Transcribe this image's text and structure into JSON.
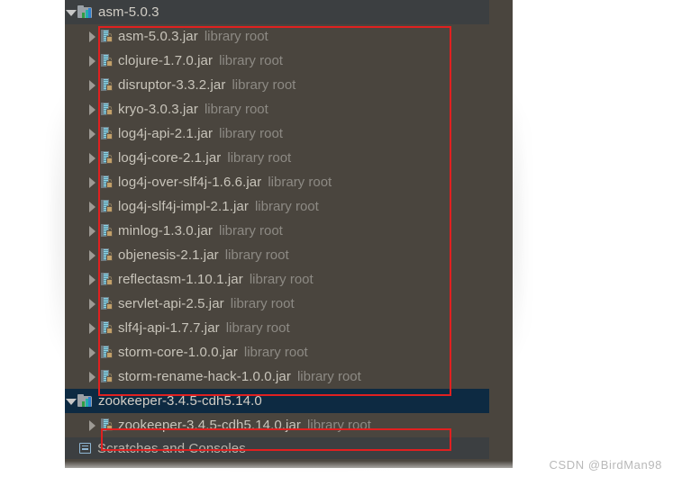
{
  "panel": {
    "kind": "project-tree",
    "colors": {
      "panel_bg": "#4a453e",
      "group_row_bg": "#3c3f41",
      "selected_row_bg": "#0d2a42",
      "gutter_bg": "#303336",
      "text": "#c8c4ba",
      "hint_text": "#8d8a84",
      "annotation_red": "#e02020"
    }
  },
  "tree": {
    "library_hint": "library root",
    "groups": [
      {
        "label": "asm-5.0.3",
        "icon": "library-folder-icon",
        "expanded": true,
        "selected": false,
        "children": [
          {
            "label": "asm-5.0.3.jar",
            "icon": "jar-icon",
            "hint": "library root"
          },
          {
            "label": "clojure-1.7.0.jar",
            "icon": "jar-icon",
            "hint": "library root"
          },
          {
            "label": "disruptor-3.3.2.jar",
            "icon": "jar-icon",
            "hint": "library root"
          },
          {
            "label": "kryo-3.0.3.jar",
            "icon": "jar-icon",
            "hint": "library root"
          },
          {
            "label": "log4j-api-2.1.jar",
            "icon": "jar-icon",
            "hint": "library root"
          },
          {
            "label": "log4j-core-2.1.jar",
            "icon": "jar-icon",
            "hint": "library root"
          },
          {
            "label": "log4j-over-slf4j-1.6.6.jar",
            "icon": "jar-icon",
            "hint": "library root"
          },
          {
            "label": "log4j-slf4j-impl-2.1.jar",
            "icon": "jar-icon",
            "hint": "library root"
          },
          {
            "label": "minlog-1.3.0.jar",
            "icon": "jar-icon",
            "hint": "library root"
          },
          {
            "label": "objenesis-2.1.jar",
            "icon": "jar-icon",
            "hint": "library root"
          },
          {
            "label": "reflectasm-1.10.1.jar",
            "icon": "jar-icon",
            "hint": "library root"
          },
          {
            "label": "servlet-api-2.5.jar",
            "icon": "jar-icon",
            "hint": "library root"
          },
          {
            "label": "slf4j-api-1.7.7.jar",
            "icon": "jar-icon",
            "hint": "library root"
          },
          {
            "label": "storm-core-1.0.0.jar",
            "icon": "jar-icon",
            "hint": "library root"
          },
          {
            "label": "storm-rename-hack-1.0.0.jar",
            "icon": "jar-icon",
            "hint": "library root"
          }
        ]
      },
      {
        "label": "zookeeper-3.4.5-cdh5.14.0",
        "icon": "library-folder-icon",
        "expanded": true,
        "selected": true,
        "children": [
          {
            "label": "zookeeper-3.4.5-cdh5.14.0.jar",
            "icon": "jar-icon",
            "hint": "library root"
          }
        ]
      }
    ],
    "bottom_node": {
      "label": "Scratches and Consoles",
      "icon": "scratches-icon"
    }
  },
  "annotations": [
    {
      "name": "redbox-jars",
      "color": "#e02020"
    },
    {
      "name": "redbox-zk",
      "color": "#e02020"
    }
  ],
  "watermark": {
    "text": "CSDN @BirdMan98"
  }
}
